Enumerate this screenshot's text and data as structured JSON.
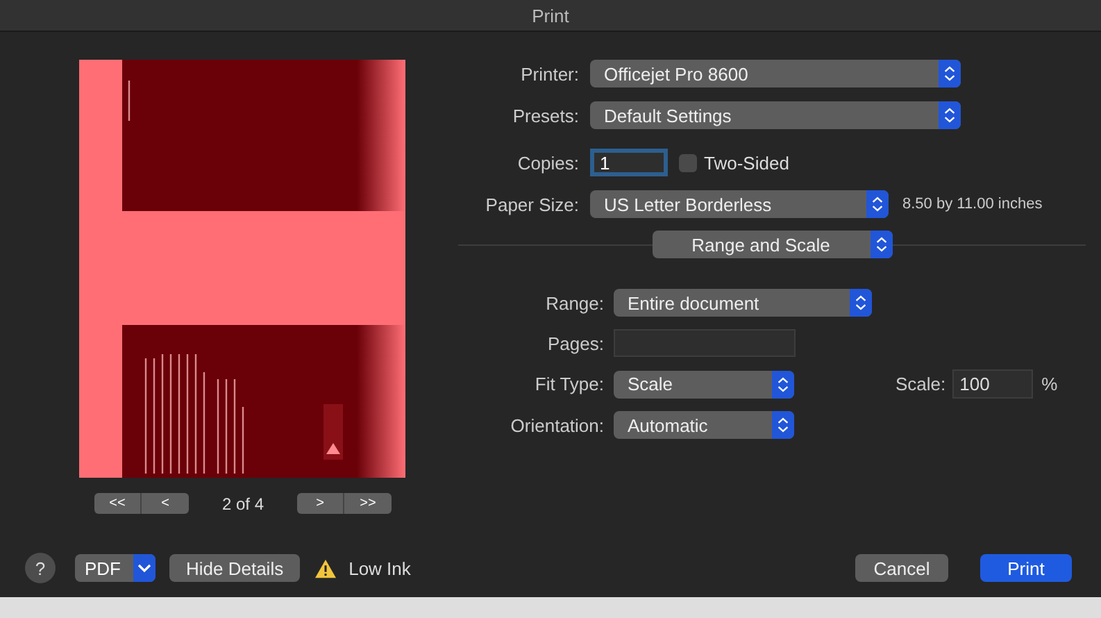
{
  "window": {
    "title": "Print"
  },
  "preview": {
    "page_indicator": "2 of 4",
    "nav_buttons": [
      "<<",
      "<",
      ">",
      ">>"
    ]
  },
  "printer": {
    "label": "Printer:",
    "value": "Officejet Pro 8600"
  },
  "presets": {
    "label": "Presets:",
    "value": "Default Settings"
  },
  "copies": {
    "label": "Copies:",
    "value": "1",
    "focused": true,
    "two_sided": {
      "label": "Two-Sided",
      "checked": false
    }
  },
  "paper_size": {
    "label": "Paper Size:",
    "value": "US Letter Borderless",
    "info": "8.50 by 11.00 inches"
  },
  "section": {
    "value": "Range and Scale"
  },
  "range": {
    "label": "Range:",
    "value": "Entire document"
  },
  "pages": {
    "label": "Pages:"
  },
  "fit_type": {
    "label": "Fit Type:",
    "value": "Scale"
  },
  "scale": {
    "label": "Scale:",
    "value": "100",
    "unit": "%"
  },
  "orientation": {
    "label": "Orientation:",
    "value": "Automatic"
  },
  "footer": {
    "help": "?",
    "pdf": "PDF",
    "hide_details": "Hide Details",
    "warning": "Low Ink",
    "cancel": "Cancel",
    "print": "Print"
  }
}
